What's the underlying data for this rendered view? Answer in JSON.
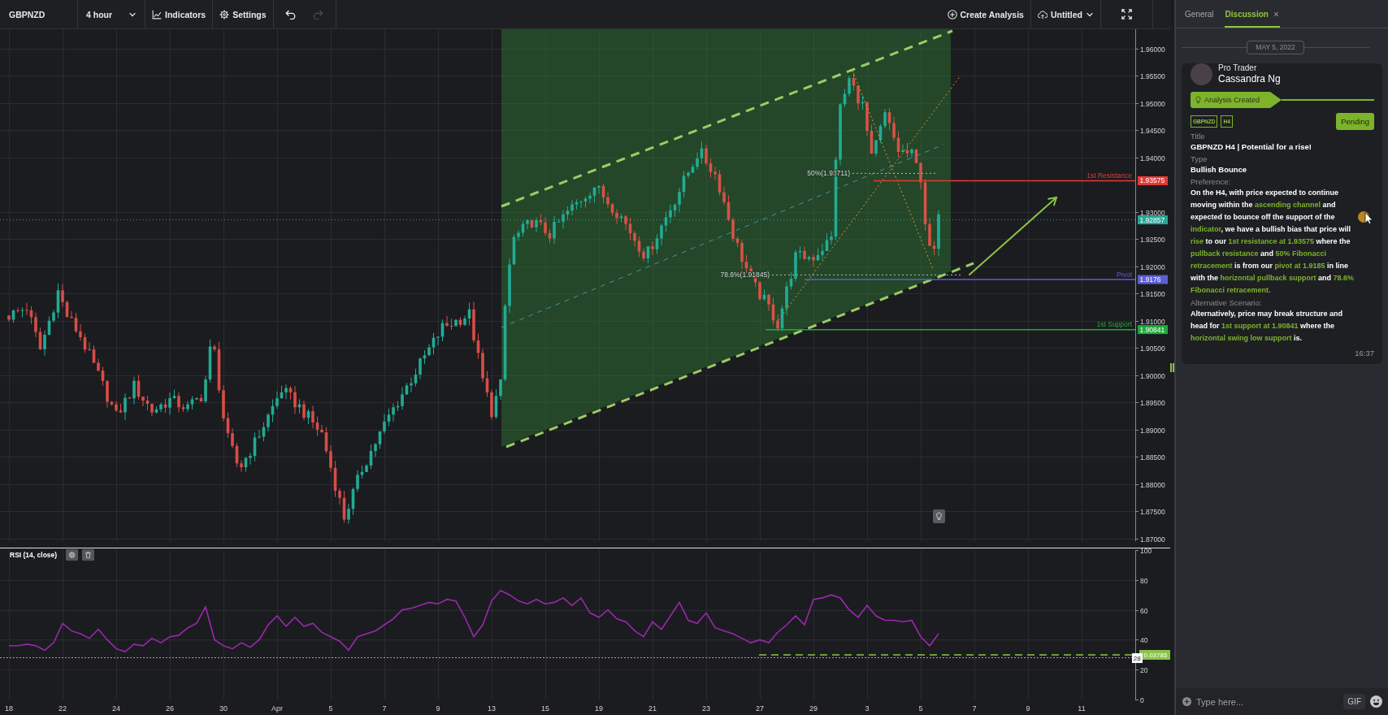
{
  "toolbar": {
    "symbol": "GBPNZD",
    "interval": {
      "label": "4 hour",
      "dropdown": true
    },
    "buttons": [
      {
        "kind": "indicators",
        "label": "Indicators"
      },
      {
        "kind": "settings",
        "label": "Settings"
      }
    ],
    "history": [
      {
        "kind": "undo",
        "disabled": false
      },
      {
        "kind": "redo",
        "disabled": true
      }
    ],
    "actions": [
      {
        "kind": "create",
        "label": "Create Analysis",
        "dropdown": false
      },
      {
        "kind": "save",
        "label": "Untitled",
        "dropdown": true
      },
      {
        "kind": "fullscreen",
        "dropdown": false
      }
    ]
  },
  "price_chart": {
    "price_ticks": [
      "1.96000",
      "1.95500",
      "1.95000",
      "1.94500",
      "1.94000",
      "1.93000",
      "1.92500",
      "1.92000",
      "1.91500",
      "1.91000",
      "1.90500",
      "1.90000",
      "1.89500",
      "1.89000",
      "1.88500",
      "1.88000",
      "1.87500",
      "1.87000"
    ],
    "levels": [
      {
        "kind": "resistance",
        "label": "1st Resistance",
        "value": "1.93575",
        "color": "#e53935"
      },
      {
        "kind": "current",
        "value": "1.92857",
        "color": "#26a69a"
      },
      {
        "kind": "pivot",
        "label": "Pivot",
        "value": "1.9176",
        "color": "#5c5fd0"
      },
      {
        "kind": "support",
        "label": "1st Support",
        "value": "1.90841",
        "color": "#1faa3c"
      }
    ],
    "fibonacci": [
      "50%(1.93711)",
      "78.6%(1.91845)"
    ]
  },
  "rsi": {
    "chart_data": {
      "type": "line",
      "title": "RSI (14, close)",
      "categories": [
        "18",
        null,
        null,
        null,
        null,
        null,
        "22",
        null,
        null,
        null,
        null,
        null,
        "24",
        null,
        null,
        null,
        null,
        null,
        "26",
        null,
        null,
        null,
        null,
        null,
        "30",
        null,
        null,
        null,
        null,
        null,
        "Apr",
        null,
        null,
        null,
        null,
        null,
        "5",
        null,
        null,
        null,
        null,
        null,
        "7",
        null,
        null,
        null,
        null,
        null,
        "9",
        null,
        null,
        null,
        null,
        null,
        "13",
        null,
        null,
        null,
        null,
        null,
        "15",
        null,
        null,
        null,
        null,
        null,
        "19",
        null,
        null,
        null,
        null,
        null,
        "21",
        null,
        null,
        null,
        null,
        null,
        "23",
        null,
        null,
        null,
        null,
        null,
        "27",
        null,
        null,
        null,
        null,
        null,
        "29",
        null,
        null,
        null,
        null,
        null,
        "3",
        null,
        null,
        null,
        null,
        null,
        "5",
        null,
        null,
        null,
        null,
        null,
        "7",
        null,
        null,
        null,
        null,
        null,
        "9",
        null,
        null,
        null,
        null,
        null,
        "11"
      ],
      "values": [
        36,
        36,
        37,
        36,
        33,
        38,
        51,
        46,
        44,
        41,
        47,
        40,
        34,
        32,
        37,
        36,
        41,
        38,
        42,
        43,
        48,
        51,
        62,
        40,
        36,
        34,
        38,
        35,
        40,
        50,
        56,
        49,
        55,
        49,
        51,
        45,
        42,
        39,
        33,
        42,
        44,
        46,
        50,
        54,
        60,
        61,
        63,
        65,
        64,
        67,
        66,
        55,
        42,
        50,
        66,
        73,
        70,
        66,
        64,
        67,
        64,
        65,
        68,
        63,
        68,
        58,
        55,
        60,
        54,
        52,
        46,
        42,
        52,
        47,
        56,
        65,
        53,
        51,
        58,
        48,
        46,
        44,
        41,
        38,
        40,
        38,
        45,
        50,
        56,
        50,
        67,
        68,
        70,
        68,
        60,
        55,
        63,
        56,
        53,
        53,
        52,
        53,
        42,
        36,
        44,
        null,
        null,
        null,
        null,
        null,
        null,
        null,
        null,
        null,
        null,
        null,
        null,
        null,
        null,
        null,
        null
      ],
      "ylim": [
        0,
        100
      ],
      "yticks": [
        0,
        20,
        40,
        60,
        80,
        100
      ],
      "grid": true,
      "ref_lines": [
        {
          "axis": "y",
          "value": 28,
          "label": "28"
        }
      ]
    },
    "value_tag": "0.03785"
  },
  "panel": {
    "tabs": [
      {
        "label": "General",
        "selected": false,
        "closable": false
      },
      {
        "label": "Discussion",
        "selected": true,
        "closable": true
      }
    ],
    "date": "MAY 5, 2022",
    "message": {
      "role": "Pro Trader",
      "author": "Cassandra Ng",
      "event": "Analysis Created",
      "tags": [
        "GBPNZD",
        "H4"
      ],
      "status": "Pending",
      "fields": [
        {
          "kind": "text",
          "label": "Title",
          "value": "GBPNZD H4 | Potential for a rise!"
        },
        {
          "kind": "text",
          "label": "Type",
          "value": "Bullish Bounce"
        },
        {
          "kind": "paragraph",
          "label": "Preference:",
          "segments": [
            {
              "kind": "text",
              "text": "On the H4, with price expected to continue moving within the "
            },
            {
              "kind": "highlight",
              "text": "ascending channel"
            },
            {
              "kind": "text",
              "text": " and expected to bounce off the support of the "
            },
            {
              "kind": "cursor"
            },
            {
              "kind": "highlight",
              "text": "indicator"
            },
            {
              "kind": "text",
              "text": ", we have a bullish bias that price will "
            },
            {
              "kind": "highlight",
              "text": "rise"
            },
            {
              "kind": "text",
              "text": " to our "
            },
            {
              "kind": "highlight",
              "text": "1st resistance at 1.93575"
            },
            {
              "kind": "text",
              "text": " where the "
            },
            {
              "kind": "highlight",
              "text": "pullback resistance"
            },
            {
              "kind": "text",
              "text": " and "
            },
            {
              "kind": "highlight",
              "text": "50% Fibonacci retracement"
            },
            {
              "kind": "text",
              "text": " is from our "
            },
            {
              "kind": "highlight",
              "text": "pivot at 1.9185"
            },
            {
              "kind": "text",
              "text": " in line with the "
            },
            {
              "kind": "highlight",
              "text": "horizontal pullback support"
            },
            {
              "kind": "text",
              "text": " and "
            },
            {
              "kind": "highlight",
              "text": "78.6% Fibonacci retracement."
            }
          ]
        },
        {
          "kind": "paragraph",
          "label": "Alternative Scenario:",
          "segments": [
            {
              "kind": "text",
              "text": "Alternatively, price may break structure and head for "
            },
            {
              "kind": "highlight",
              "text": "1st support at 1.90841"
            },
            {
              "kind": "text",
              "text": " where the "
            },
            {
              "kind": "highlight",
              "text": "horizontal swing low support"
            },
            {
              "kind": "text",
              "text": " is."
            }
          ]
        }
      ],
      "time": "16:37"
    },
    "composer": {
      "placeholder": "Type here...",
      "gif": "GIF"
    }
  }
}
